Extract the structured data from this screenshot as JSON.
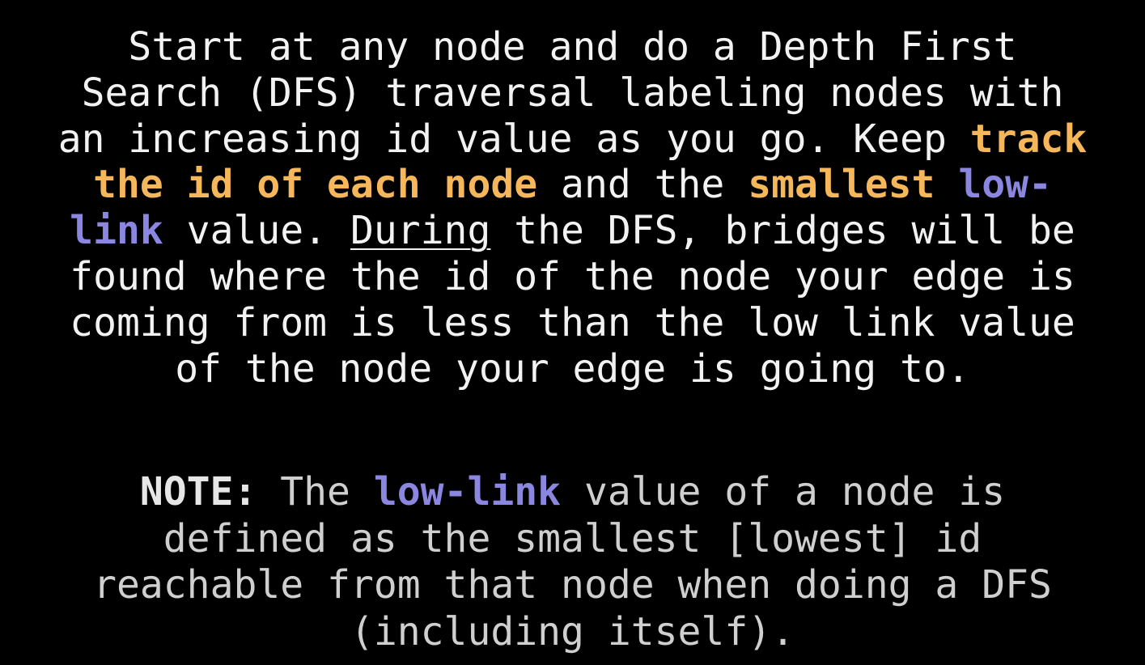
{
  "colors": {
    "background": "#000000",
    "text": "#f2f2f2",
    "note_text": "#cfcfcf",
    "highlight_orange": "#f5b75a",
    "highlight_purple": "#8b86e0"
  },
  "main": {
    "line1": "Start at any node and do a Depth First",
    "line2": "Search (DFS) traversal labeling nodes with",
    "line3_a": "an increasing id value as you go. Keep ",
    "line3_b": "track",
    "line4_a": "the id of each node",
    "line4_b": " and the ",
    "line4_c": "smallest",
    "line4_d": " ",
    "line4_e": "low-",
    "line5_a": "link",
    "line5_b": " value. ",
    "line5_c": "During",
    "line5_d": " the DFS, bridges will be",
    "line6": "found where the id of the node your edge is",
    "line7": "coming from is less than the low link value",
    "line8": "of the node your edge is going to."
  },
  "note": {
    "label": "NOTE:",
    "line1_a": " The ",
    "line1_b": "low-link",
    "line1_c": " value of a node is",
    "line2": "defined as the smallest [lowest] id",
    "line3": "reachable from that node when doing a DFS",
    "line4": "(including itself)."
  }
}
